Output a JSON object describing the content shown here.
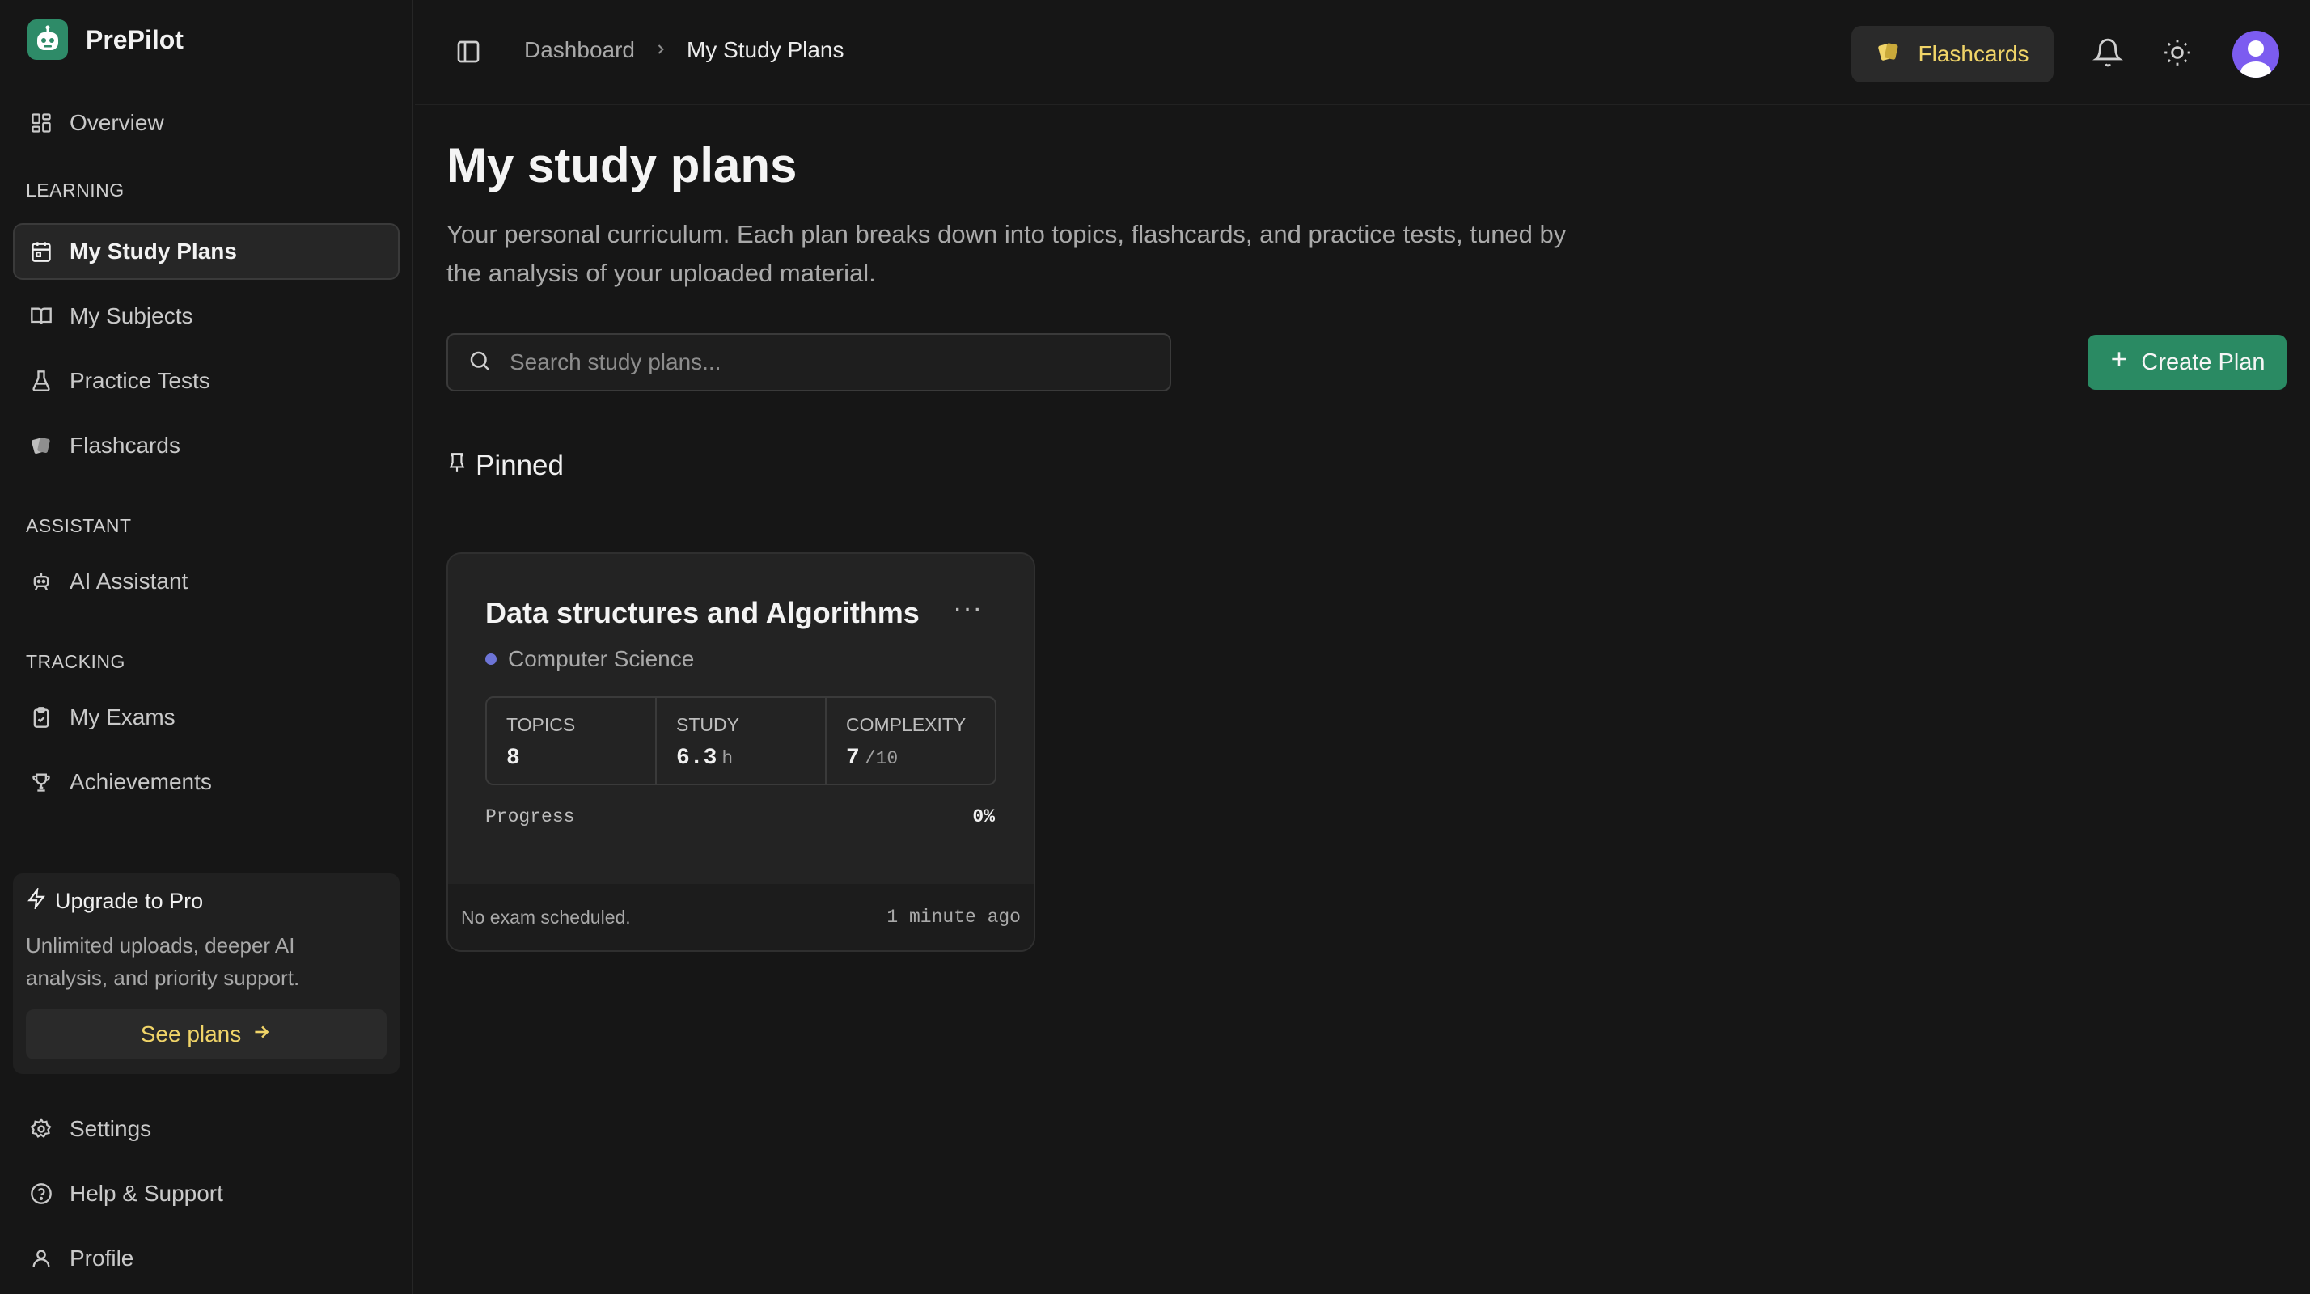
{
  "app": {
    "name": "PrePilot",
    "logo_icon": "robot-icon",
    "accent": "#2e8b68"
  },
  "sidebar": {
    "overview": {
      "label": "Overview",
      "icon": "grid-icon"
    },
    "sections": {
      "learning": "LEARNING",
      "assistant": "ASSISTANT",
      "tracking": "TRACKING"
    },
    "learning_items": [
      {
        "label": "My Study Plans",
        "icon": "calendar-icon",
        "active": true
      },
      {
        "label": "My Subjects",
        "icon": "book-icon"
      },
      {
        "label": "Practice Tests",
        "icon": "flask-icon"
      },
      {
        "label": "Flashcards",
        "icon": "cards-icon"
      }
    ],
    "assistant_items": [
      {
        "label": "AI Assistant",
        "icon": "bot-icon"
      }
    ],
    "tracking_items": [
      {
        "label": "My Exams",
        "icon": "clipboard-icon"
      },
      {
        "label": "Achievements",
        "icon": "trophy-icon"
      }
    ],
    "upgrade": {
      "title": "Upgrade to Pro",
      "description": "Unlimited uploads, deeper AI analysis, and priority support.",
      "button": "See plans"
    },
    "footer_items": [
      {
        "label": "Settings",
        "icon": "gear-icon"
      },
      {
        "label": "Help & Support",
        "icon": "help-icon"
      },
      {
        "label": "Profile",
        "icon": "user-icon"
      }
    ]
  },
  "topbar": {
    "breadcrumb": [
      "Dashboard",
      "My Study Plans"
    ],
    "flashcards_button": "Flashcards",
    "flashcards_color": "#f0d468"
  },
  "main": {
    "title": "My study plans",
    "description": "Your personal curriculum. Each plan breaks down into topics, flashcards, and practice tests, tuned by the analysis of your uploaded material.",
    "search": {
      "placeholder": "Search study plans...",
      "value": ""
    },
    "create_button": "Create Plan",
    "pinned_heading": "Pinned"
  },
  "plans": [
    {
      "title": "Data structures and Algorithms",
      "subject": "Computer Science",
      "subject_color": "#6d74d6",
      "more": "···",
      "stats": {
        "topics_label": "TOPICS",
        "topics": "8",
        "study_label": "STUDY",
        "study": "6.3",
        "study_unit": "h",
        "complexity_label": "COMPLEXITY",
        "complexity": "7",
        "complexity_unit": "/10"
      },
      "progress_label": "Progress",
      "progress": "0%",
      "exam_status": "No exam scheduled.",
      "updated": "1 minute ago"
    }
  ]
}
